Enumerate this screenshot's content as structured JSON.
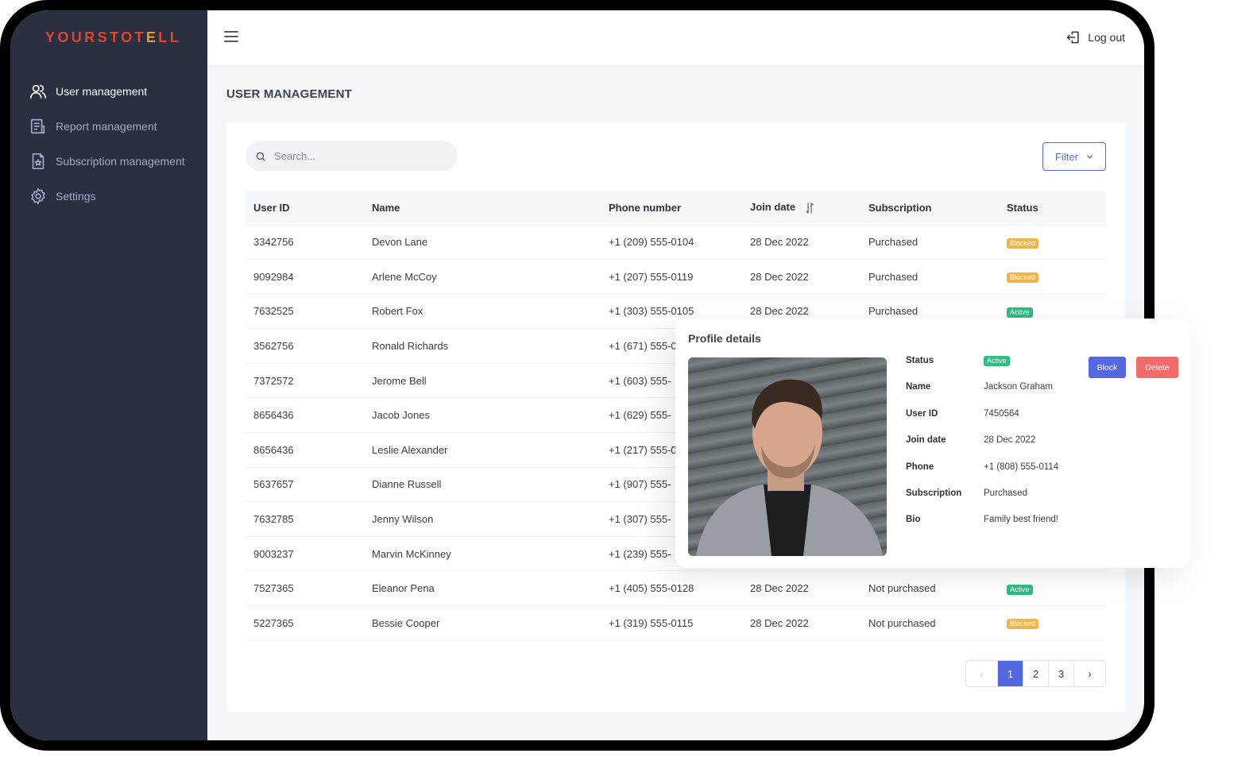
{
  "app": {
    "logo_text": "YOURSTOTELL"
  },
  "sidebar": {
    "items": [
      {
        "label": "User management",
        "icon": "users-icon",
        "active": true
      },
      {
        "label": "Report management",
        "icon": "report-icon",
        "active": false
      },
      {
        "label": "Subscription management",
        "icon": "subscription-icon",
        "active": false
      },
      {
        "label": "Settings",
        "icon": "gear-icon",
        "active": false
      }
    ]
  },
  "topbar": {
    "menu_icon": "hamburger-icon",
    "logout_label": "Log out",
    "logout_icon": "logout-icon"
  },
  "page": {
    "title": "USER MANAGEMENT"
  },
  "search": {
    "placeholder": "Search...",
    "value": ""
  },
  "filter": {
    "label": "Filter"
  },
  "table": {
    "headers": [
      "User ID",
      "Name",
      "Phone number",
      "Join date",
      "Subscription",
      "Status"
    ],
    "sortable_column": "Join date",
    "rows": [
      {
        "id": "3342756",
        "name": "Devon Lane",
        "phone": "+1 (209) 555-0104",
        "date": "28 Dec 2022",
        "subscription": "Purchased",
        "status": "Blocked"
      },
      {
        "id": "9092984",
        "name": "Arlene McCoy",
        "phone": "+1 (207) 555-0119",
        "date": "28 Dec 2022",
        "subscription": "Purchased",
        "status": "Blocked"
      },
      {
        "id": "7632525",
        "name": "Robert Fox",
        "phone": "+1 (303) 555-0105",
        "date": "28 Dec 2022",
        "subscription": "Purchased",
        "status": "Active"
      },
      {
        "id": "3562756",
        "name": "Ronald Richards",
        "phone": "+1 (671) 555-0",
        "date": "",
        "subscription": "",
        "status": ""
      },
      {
        "id": "7372572",
        "name": "Jerome Bell",
        "phone": "+1 (603) 555-",
        "date": "",
        "subscription": "",
        "status": ""
      },
      {
        "id": "8656436",
        "name": "Jacob Jones",
        "phone": "+1 (629) 555-",
        "date": "",
        "subscription": "",
        "status": ""
      },
      {
        "id": "8656436",
        "name": "Leslie Alexander",
        "phone": "+1 (217) 555-0",
        "date": "",
        "subscription": "",
        "status": ""
      },
      {
        "id": "5637657",
        "name": "Dianne Russell",
        "phone": "+1 (907) 555-",
        "date": "",
        "subscription": "",
        "status": ""
      },
      {
        "id": "7632785",
        "name": "Jenny Wilson",
        "phone": "+1 (307) 555-",
        "date": "",
        "subscription": "",
        "status": ""
      },
      {
        "id": "9003237",
        "name": "Marvin McKinney",
        "phone": "+1 (239) 555-",
        "date": "",
        "subscription": "",
        "status": ""
      },
      {
        "id": "7527365",
        "name": "Eleanor Pena",
        "phone": "+1 (405) 555-0128",
        "date": "28 Dec 2022",
        "subscription": "Not purchased",
        "status": "Active"
      },
      {
        "id": "5227365",
        "name": "Bessie Cooper",
        "phone": "+1 (319) 555-0115",
        "date": "28 Dec 2022",
        "subscription": "Not purchased",
        "status": "Blocked"
      }
    ]
  },
  "pagination": {
    "prev": "‹",
    "pages": [
      "1",
      "2",
      "3"
    ],
    "current": "1",
    "next": "›"
  },
  "profile": {
    "title": "Profile details",
    "block_label": "Block",
    "delete_label": "Delete",
    "fields": [
      {
        "label": "Status",
        "value": "Active",
        "type": "badge"
      },
      {
        "label": "Name",
        "value": "Jackson Graham"
      },
      {
        "label": "User ID",
        "value": "7450564"
      },
      {
        "label": "Join date",
        "value": "28 Dec 2022"
      },
      {
        "label": "Phone",
        "value": "+1 (808) 555-0114"
      },
      {
        "label": "Subscription",
        "value": "Purchased"
      },
      {
        "label": "Bio",
        "value": "Family best friend!"
      }
    ]
  },
  "colors": {
    "sidebar_bg": "#2a2f41",
    "logo": "#e0462a",
    "accent": "#5468e0",
    "blocked": "#f0b54a",
    "active": "#2ebd82",
    "danger": "#f26b6b"
  }
}
